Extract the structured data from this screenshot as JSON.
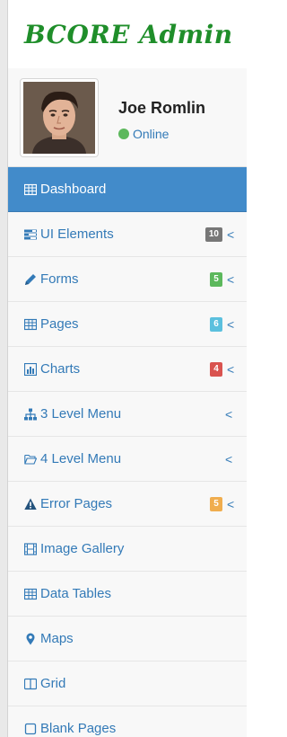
{
  "brand": {
    "title": "BCORE Admin"
  },
  "user": {
    "name": "Joe Romlin",
    "status": "Online"
  },
  "colors": {
    "accent": "#428bca",
    "link": "#337ab7",
    "badge_default": "#777777",
    "badge_success": "#5cb85c",
    "badge_info": "#5bc0de",
    "badge_danger": "#d9534f",
    "badge_warning": "#f0ad4e",
    "online": "#5cb85c",
    "brand": "#1f8e2a"
  },
  "menu": {
    "items": [
      {
        "label": "Dashboard",
        "icon": "table-icon"
      },
      {
        "label": "UI Elements",
        "icon": "tasks-icon",
        "badge": "10",
        "chevron": "<"
      },
      {
        "label": "Forms",
        "icon": "pencil-icon",
        "badge": "5",
        "chevron": "<"
      },
      {
        "label": "Pages",
        "icon": "table-icon",
        "badge": "6",
        "chevron": "<"
      },
      {
        "label": "Charts",
        "icon": "bar-chart-icon",
        "badge": "4",
        "chevron": "<"
      },
      {
        "label": "3 Level Menu",
        "icon": "sitemap-icon",
        "chevron": "<"
      },
      {
        "label": "4 Level Menu",
        "icon": "folder-open-icon",
        "chevron": "<"
      },
      {
        "label": "Error Pages",
        "icon": "warning-icon",
        "badge": "5",
        "chevron": "<"
      },
      {
        "label": "Image Gallery",
        "icon": "film-icon"
      },
      {
        "label": "Data Tables",
        "icon": "table-icon"
      },
      {
        "label": "Maps",
        "icon": "map-marker-icon"
      },
      {
        "label": "Grid",
        "icon": "columns-icon"
      },
      {
        "label": "Blank Pages",
        "icon": "square-icon"
      }
    ]
  }
}
